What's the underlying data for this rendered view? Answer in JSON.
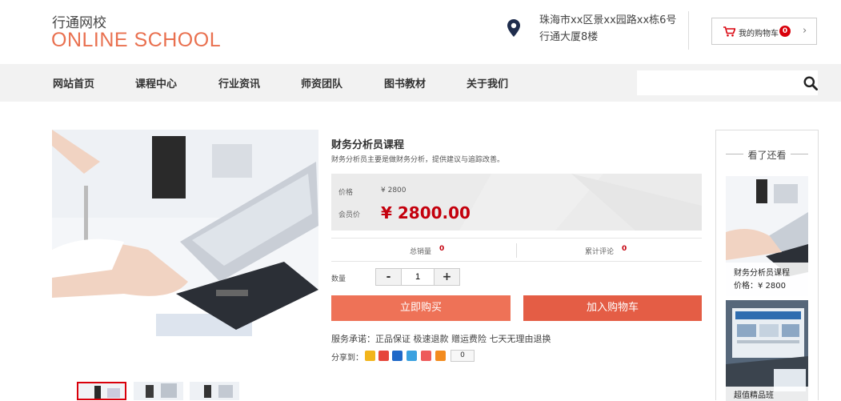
{
  "header": {
    "logo_cn": "行通网校",
    "logo_en": "ONLINE SCHOOL",
    "address_line1": "珠海市xx区景xx园路xx栋6号",
    "address_line2": "行通大厦8楼",
    "cart_label": "我的购物车",
    "cart_count": "0",
    "cart_arrow": "›"
  },
  "nav": {
    "items": [
      "网站首页",
      "课程中心",
      "行业资讯",
      "师资团队",
      "图书教材",
      "关于我们"
    ],
    "search_value": ""
  },
  "product": {
    "title": "财务分析员课程",
    "description": "财务分析员主要是做财务分析，提供建议与追踪改善。",
    "price_label": "价格",
    "price_value": "¥ 2800",
    "member_label": "会员价",
    "member_price": "¥ 2800.00",
    "sales_label": "总销量",
    "sales_value": "0",
    "reviews_label": "累计评论",
    "reviews_value": "0",
    "qty_label": "数量",
    "qty_minus": "-",
    "qty_value": "1",
    "qty_plus": "+",
    "buy_now": "立即购买",
    "add_to_cart": "加入购物车",
    "promise": "服务承诺：正品保证 极速退款 赠运费险 七天无理由退换",
    "share_label": "分享到：",
    "share_count": "0"
  },
  "sidebar": {
    "title": "看了还看",
    "cards": [
      {
        "name": "财务分析员课程",
        "price": "价格：¥ 2800"
      },
      {
        "name": "超值精品班"
      }
    ]
  },
  "colors": {
    "accent": "#e9704f",
    "buy_button": "#ee7257",
    "cart_button": "#e45d45",
    "price_red": "#c4000d",
    "nav_bg": "#f2f2f2"
  },
  "icons": [
    "location-pin-icon",
    "cart-icon",
    "search-icon",
    "qzone-icon",
    "weibo-icon",
    "renren-icon",
    "tencent-weibo-icon",
    "qq-icon",
    "more-share-icon"
  ]
}
